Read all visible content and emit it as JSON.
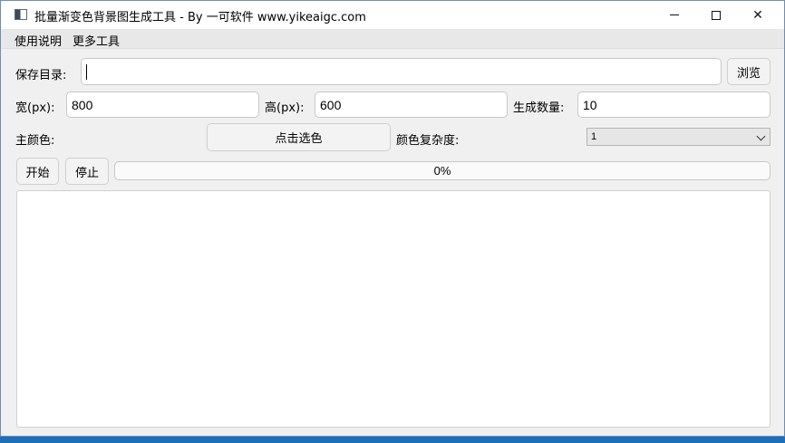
{
  "window": {
    "title": "批量渐变色背景图生成工具 - By 一可软件 www.yikeaigc.com",
    "controls": {
      "minimize": "",
      "maximize": "",
      "close": "✕"
    }
  },
  "menu": {
    "items": [
      "使用说明",
      "更多工具"
    ]
  },
  "form": {
    "save_dir_label": "保存目录:",
    "save_dir_value": "",
    "browse_button": "浏览",
    "width_label": "宽(px):",
    "width_value": "800",
    "height_label": "高(px):",
    "height_value": "600",
    "count_label": "生成数量:",
    "count_value": "10",
    "main_color_label": "主颜色:",
    "pick_color_button": "点击选色",
    "complexity_label": "颜色复杂度:",
    "complexity_value": "1"
  },
  "actions": {
    "start_button": "开始",
    "stop_button": "停止"
  },
  "progress": {
    "value": 0,
    "text": "0%"
  },
  "log": {
    "content": ""
  }
}
